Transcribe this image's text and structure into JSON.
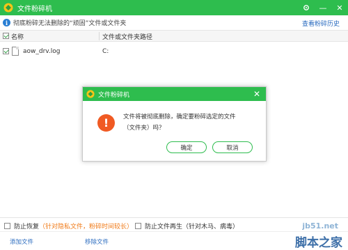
{
  "window": {
    "title": "文件粉碎机",
    "settings_icon": "gear-icon",
    "minimize": "—",
    "close": "✕"
  },
  "info": {
    "text": "彻底粉碎无法删除的“顽固”文件或文件夹",
    "history_link": "查看粉碎历史"
  },
  "table": {
    "columns": [
      "名称",
      "文件或文件夹路径"
    ],
    "rows": [
      {
        "name": "aow_drv.log",
        "path": "C:",
        "checked": true
      }
    ]
  },
  "dialog": {
    "title": "文件粉碎机",
    "icon": "!",
    "message_line1": "文件将被彻底删除，确定要粉碎选定的文件",
    "message_line2": "（文件夹）吗？",
    "ok_label": "确定",
    "cancel_label": "取消",
    "close": "✕"
  },
  "options": {
    "prevent_recovery": "防止恢复",
    "prevent_recovery_note": "（针对隐私文件，粉碎时间较长）",
    "prevent_regen": "防止文件再生",
    "prevent_regen_note": "（针对木马、病毒）"
  },
  "footer": {
    "add_file": "添加文件",
    "remove_file": "移除文件"
  },
  "watermark": {
    "site": "jb51.net",
    "brand": "脚本之家"
  },
  "colors": {
    "accent": "#2ebd4e",
    "warning": "#f05a23",
    "link": "#2a6bbf"
  }
}
